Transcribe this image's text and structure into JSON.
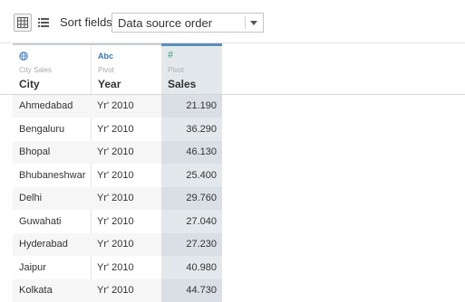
{
  "toolbar": {
    "sort_label": "Sort fields",
    "sort_value": "Data source order",
    "grid_view_icon": "grid-icon",
    "list_view_icon": "list-icon"
  },
  "columns": [
    {
      "type_icon": "globe-icon",
      "type_glyph": "🌐",
      "type_color": "#3a74b3",
      "source": "City Sales",
      "name": "City"
    },
    {
      "type_icon": "abc-icon",
      "type_glyph": "Abc",
      "type_color": "#3a74b3",
      "source": "Pivot",
      "name": "Year"
    },
    {
      "type_icon": "hash-icon",
      "type_glyph": "#",
      "type_color": "#3aa47a",
      "source": "Pivot",
      "name": "Sales"
    }
  ],
  "rows": [
    {
      "city": "Ahmedabad",
      "year": "Yr' 2010",
      "sales": "21.190"
    },
    {
      "city": "Bengaluru",
      "year": "Yr' 2010",
      "sales": "36.290"
    },
    {
      "city": "Bhopal",
      "year": "Yr' 2010",
      "sales": "46.130"
    },
    {
      "city": "Bhubaneshwar",
      "year": "Yr' 2010",
      "sales": "25.400"
    },
    {
      "city": "Delhi",
      "year": "Yr' 2010",
      "sales": "29.760"
    },
    {
      "city": "Guwahati",
      "year": "Yr' 2010",
      "sales": "27.040"
    },
    {
      "city": "Hyderabad",
      "year": "Yr' 2010",
      "sales": "27.230"
    },
    {
      "city": "Jaipur",
      "year": "Yr' 2010",
      "sales": "40.980"
    },
    {
      "city": "Kolkata",
      "year": "Yr' 2010",
      "sales": "44.730"
    }
  ]
}
